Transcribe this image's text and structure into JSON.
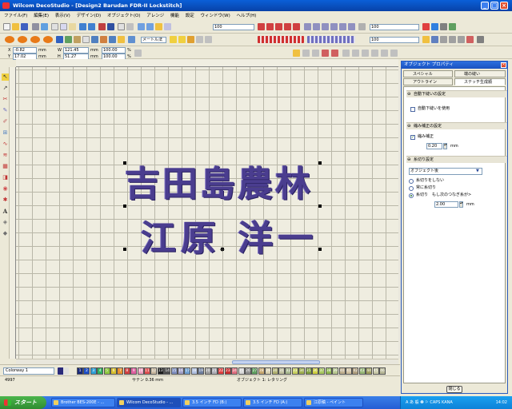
{
  "window": {
    "title": "Wilcom DecoStudio - [Design2     Barudan FDR-II Lockstitch]"
  },
  "menu": [
    "ファイル(F)",
    "編集(E)",
    "表示(V)",
    "デザイン(D)",
    "オブジェクト(O)",
    "アレンジ",
    "機能",
    "設定",
    "ウィンドウ(W)",
    "ヘルプ(H)"
  ],
  "toolbar": {
    "zoom_value": "100",
    "font_label": "メートル法",
    "stitch_value": "100",
    "right_value": "100"
  },
  "coords": {
    "x_label": "X",
    "x_value": "-0.82",
    "x_unit": "mm",
    "y_label": "Y",
    "y_value": "17.02",
    "y_unit": "mm",
    "w_label": "W",
    "w_value": "121.45",
    "w_unit": "mm",
    "h_label": "H",
    "h_value": "51.27",
    "h_unit": "mm",
    "sx_value": "100.00",
    "sx_unit": "%",
    "sy_value": "100.00",
    "sy_unit": "%"
  },
  "canvas": {
    "line1": "吉田島農林",
    "line2": "江原 洋一"
  },
  "palette": {
    "colorway": "Colorway 1",
    "swatches": [
      {
        "num": "1",
        "color": "#1a2a7a"
      },
      {
        "num": "2",
        "color": "#1e50c8"
      },
      {
        "num": "3",
        "color": "#30a0d8"
      },
      {
        "num": "4",
        "color": "#30b060"
      },
      {
        "num": "5",
        "color": "#90c840"
      },
      {
        "num": "6",
        "color": "#d8c030"
      },
      {
        "num": "7",
        "color": "#e89030"
      },
      {
        "num": "8",
        "color": "#d04040"
      },
      {
        "num": "9",
        "color": "#e060a0"
      },
      {
        "num": "10",
        "color": "#f0a0c0"
      },
      {
        "num": "11",
        "color": "#e05050"
      },
      {
        "num": "12",
        "color": "#c8b8a0"
      },
      {
        "num": "13",
        "color": "#202020"
      },
      {
        "num": "14",
        "color": "#505050"
      },
      {
        "num": "15",
        "color": "#8090c0"
      },
      {
        "num": "16",
        "color": "#a0a0c8"
      },
      {
        "num": "17",
        "color": "#70a0d0"
      },
      {
        "num": "18",
        "color": "#b0c0e0"
      },
      {
        "num": "19",
        "color": "#7080a0"
      },
      {
        "num": "20",
        "color": "#a0a0a0"
      },
      {
        "num": "21",
        "color": "#b0b0b8"
      },
      {
        "num": "22",
        "color": "#e04040"
      },
      {
        "num": "23",
        "color": "#c83030"
      },
      {
        "num": "24",
        "color": "#e07080"
      },
      {
        "num": "25",
        "color": "#d8d8d8"
      },
      {
        "num": "26",
        "color": "#909090"
      },
      {
        "num": "27",
        "color": "#60a060"
      },
      {
        "num": "28",
        "color": "#c8a870"
      },
      {
        "num": "29",
        "color": "#d8d0b0"
      },
      {
        "num": "30",
        "color": "#b0b070"
      },
      {
        "num": "31",
        "color": "#c0c0a0"
      },
      {
        "num": "32",
        "color": "#a8b890"
      },
      {
        "num": "33",
        "color": "#c8d060"
      },
      {
        "num": "34",
        "color": "#a0b050"
      },
      {
        "num": "35",
        "color": "#80a040"
      },
      {
        "num": "36",
        "color": "#d0d040"
      },
      {
        "num": "37",
        "color": "#a8c860"
      },
      {
        "num": "38",
        "color": "#90b850"
      },
      {
        "num": "39",
        "color": "#b8c890"
      },
      {
        "num": "40",
        "color": "#c0b090"
      },
      {
        "num": "41",
        "color": "#d0c0a0"
      },
      {
        "num": "42",
        "color": "#b0a080"
      },
      {
        "num": "43",
        "color": "#98b878"
      },
      {
        "num": "44",
        "color": "#a0a060"
      },
      {
        "num": "45",
        "color": "#c8c8a8"
      },
      {
        "num": "46",
        "color": "#b8b898"
      }
    ]
  },
  "status": {
    "stitches": "4997",
    "seam": "サテン 0.36 mm",
    "object": "オブジェクト 1: レタリング"
  },
  "panel": {
    "title": "オブジェクト プロパティ",
    "tabs": [
      "スペシャル",
      "端の縫い",
      "アウトライン",
      "ステッチ生成順"
    ],
    "section1": "自動下縫いの設定",
    "auto_underlay_label": "自動下縫いを使用",
    "section2": "縮み補正の設定",
    "pull_comp_label": "縮み補正",
    "pull_comp_value": "0.20",
    "pull_comp_unit": "mm",
    "section3": "糸切り設定",
    "trim_select": "オブジェクト後",
    "radio1": "糸切りをしない",
    "radio2": "常に糸切り",
    "radio3": "糸切り　もし次のつなぎ糸が>",
    "trim_value": "2.00",
    "trim_unit": "mm",
    "close_label": "閉じる"
  },
  "taskbar": {
    "start": "スタート",
    "tasks": [
      "Brother BES-200E - ...",
      "Wilcom DecoStudio - ...",
      "3.5 インチ FD (B:)",
      "3.5 インチ FD (A:)",
      "江原稿 - ペイント"
    ],
    "clock": "14:02",
    "tray_text": "A あ 般 ❷ ⚐ CAPS KANA"
  }
}
